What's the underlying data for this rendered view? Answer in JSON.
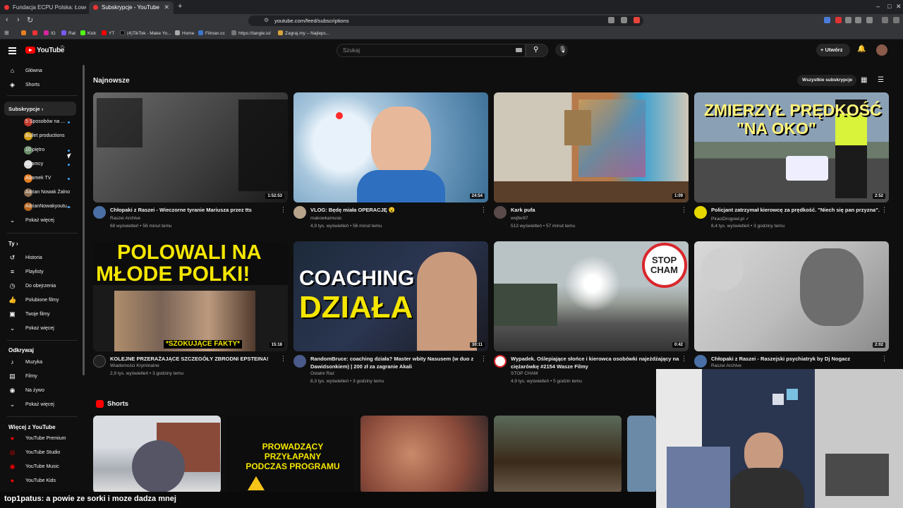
{
  "browser": {
    "tabs": [
      {
        "title": "Fundacja ECPU Polska: Łowcy Pedofili"
      },
      {
        "title": "Subskrypcje - YouTube"
      }
    ],
    "url": "youtube.com/feed/subscriptions",
    "bookmarks": [
      "IG",
      "Rat",
      "Kick",
      "YT",
      "(4)TikTok - Make Yo...",
      "Home",
      "Filman.cc",
      "https://tangle.io/",
      "Zagraj.my – Najleps..."
    ]
  },
  "youtube": {
    "logo_text": "YouTube",
    "country": "PL",
    "search_placeholder": "Szukaj",
    "create_label": "+ Utwórz"
  },
  "sidebar": {
    "top": [
      {
        "label": "Główna",
        "icon": "home-icon"
      },
      {
        "label": "Shorts",
        "icon": "shorts-icon"
      }
    ],
    "subscriptions_header": "Subskrypcje ›",
    "subscriptions": [
      {
        "label": "5 Sposobów na ...",
        "new": true
      },
      {
        "label": "Bullet productions",
        "new": false
      },
      {
        "label": "10 piętro",
        "new": true
      },
      {
        "label": "Adamcy",
        "new": true
      },
      {
        "label": "Adamek TV",
        "new": true
      },
      {
        "label": "Adrian Nowak Żalno",
        "new": false
      },
      {
        "label": "AdrianNowakyoutu...",
        "new": true
      },
      {
        "label": "Pokaż więcej",
        "new": false
      }
    ],
    "you_header": "Ty ›",
    "you": [
      {
        "label": "Historia",
        "icon": "history-icon"
      },
      {
        "label": "Playlisty",
        "icon": "playlist-icon"
      },
      {
        "label": "Do obejrzenia",
        "icon": "watch-later-icon"
      },
      {
        "label": "Polubione filmy",
        "icon": "like-icon"
      },
      {
        "label": "Twoje filmy",
        "icon": "your-videos-icon"
      },
      {
        "label": "Pokaż więcej",
        "icon": "chevron-down-icon"
      }
    ],
    "explore_header": "Odkrywaj",
    "explore": [
      {
        "label": "Muzyka",
        "icon": "music-icon"
      },
      {
        "label": "Filmy",
        "icon": "film-icon"
      },
      {
        "label": "Na żywo",
        "icon": "live-icon"
      },
      {
        "label": "Pokaż więcej",
        "icon": "chevron-down-icon"
      }
    ],
    "more_header": "Więcej z YouTube",
    "more": [
      {
        "label": "YouTube Premium"
      },
      {
        "label": "YouTube Studio"
      },
      {
        "label": "YouTube Music"
      },
      {
        "label": "YouTube Kids"
      }
    ]
  },
  "main": {
    "section_title": "Najnowsze",
    "all_subs_label": "Wszystkie subskrypcje",
    "videos": [
      {
        "title": "Chłopaki z Raszei - Wieczorne tyranie Mariusza przez tts",
        "channel": "Raszei Archive",
        "meta": "68 wyświetleń • 56 minut temu",
        "duration": "1:52:53"
      },
      {
        "title": "VLOG: Będę miała OPERACJĘ 😮",
        "channel": "makowkamusic",
        "meta": "4,9 tys. wyświetleń • 56 minut temu",
        "duration": "24:54"
      },
      {
        "title": "Kark pufa",
        "channel": "wojfer87",
        "meta": "513 wyświetleń • 57 minut temu",
        "duration": "1:09"
      },
      {
        "title": "Policjant zatrzymał kierowcę za prędkość. \"Niech się pan przyzna\".",
        "channel": "PiraciDrogowi.pl ✓",
        "meta": "8,4 tys. wyświetleń • 3 godziny temu",
        "duration": "2:52",
        "thumb_text": [
          "ZMIERZYŁ PRĘDKOŚĆ",
          "\"NA OKO\""
        ]
      },
      {
        "title": "KOLEJNE PRZERAŻAJĄCE SZCZEGÓŁY ZBRODNI EPSTEINA!",
        "channel": "Wiadomości Kryminalne",
        "meta": "2,9 tys. wyświetleń • 3 godziny temu",
        "duration": "15:18",
        "thumb_text": [
          "POLOWALI NA",
          "MŁODE POLKI!",
          "*SZOKUJĄCE FAKTY*"
        ]
      },
      {
        "title": "RandomBruce: coaching działa? Master wbity Nasusem (w duo z Dawidsonkiem) | 200 zł za zagranie Akali",
        "channel": "Ostatni Raz",
        "meta": "8,3 tys. wyświetleń • 3 godziny temu",
        "duration": "30:11",
        "thumb_text": [
          "COACHING",
          "DZIAŁA"
        ]
      },
      {
        "title": "Wypadek. Oślepiające słońce i kierowca osobówki najeżdżający na ciężarówkę #2154 Wasze Filmy",
        "channel": "STOP CHAM",
        "meta": "4,9 tys. wyświetleń • 5 godzin temu",
        "duration": "0:42",
        "thumb_text": [
          "STOP",
          "CHAM"
        ]
      },
      {
        "title": "Chłopaki z Raszei - Raszejski psychiatryk by Dj Nogacz",
        "channel": "Raszei Archive",
        "meta": "",
        "duration": "2:02"
      }
    ],
    "shorts_label": "Shorts",
    "shorts_thumb_text": [
      "PROWADZĄCY PRZYŁAPANY",
      "PODCZAS PROGRAMU"
    ]
  },
  "chat": {
    "user": "top1patus",
    "message": ": a powie ze sorki i moze dadza mnej"
  }
}
